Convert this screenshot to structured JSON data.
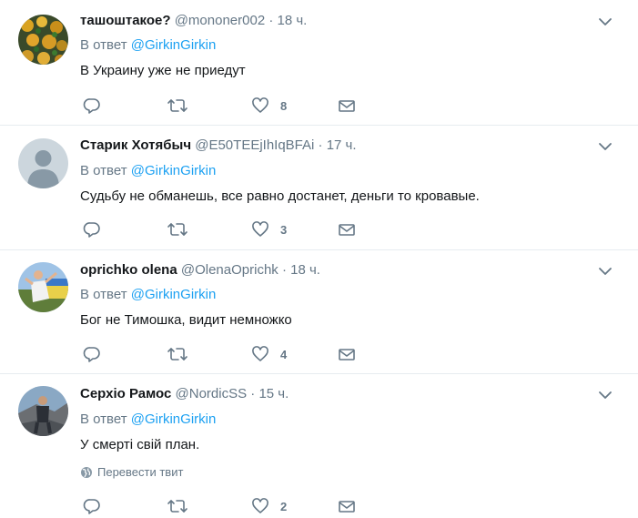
{
  "tweets": [
    {
      "name": "ташоштакое?",
      "handle": "@mononer002",
      "sep": "·",
      "time": "18 ч.",
      "reply_prefix": "В ответ",
      "reply_to": "@GirkinGirkin",
      "text": "В Украину уже не приедут",
      "likes": "8"
    },
    {
      "name": "Старик Хотябыч",
      "handle": "@E50TEEjIhIqBFAi",
      "sep": "·",
      "time": "17 ч.",
      "reply_prefix": "В ответ",
      "reply_to": "@GirkinGirkin",
      "text": "Судьбу не обманешь, все равно достанет, деньги то кровавые.",
      "likes": "3"
    },
    {
      "name": "oprichko olena",
      "handle": "@OlenaOprichk",
      "sep": "·",
      "time": "18 ч.",
      "reply_prefix": "В ответ",
      "reply_to": "@GirkinGirkin",
      "text": "Бог не Тимошка, видит немножко",
      "likes": "4"
    },
    {
      "name": "Серхіо Рамос",
      "handle": "@NordicSS",
      "sep": "·",
      "time": "15 ч.",
      "reply_prefix": "В ответ",
      "reply_to": "@GirkinGirkin",
      "text": "У смерті свій план.",
      "likes": "2",
      "translate": "Перевести твит"
    }
  ],
  "icons": {
    "reply": "reply-icon",
    "retweet": "retweet-icon",
    "like": "heart-icon",
    "dm": "envelope-icon",
    "menu": "chevron-down-icon",
    "globe": "globe-icon"
  },
  "colors": {
    "link": "#1da1f2",
    "muted": "#657786",
    "text": "#14171a",
    "divider": "#e6ecf0"
  }
}
